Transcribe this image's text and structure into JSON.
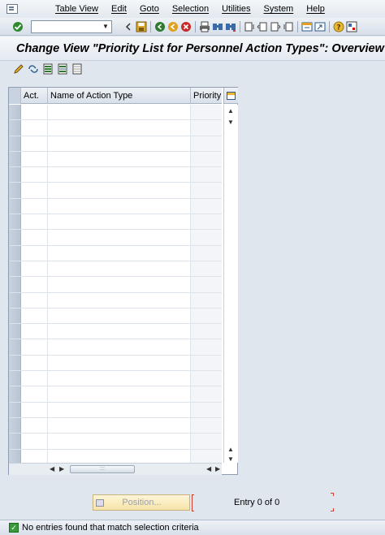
{
  "menubar": {
    "items": [
      "Table View",
      "Edit",
      "Goto",
      "Selection",
      "Utilities",
      "System",
      "Help"
    ]
  },
  "toolbar": {
    "command_field_value": "",
    "icons": [
      "enter-icon",
      "back-icon",
      "save-icon",
      "exit-icon",
      "cancel-icon",
      "print-icon",
      "find-icon",
      "find-next-icon",
      "first-page-icon",
      "previous-page-icon",
      "next-page-icon",
      "last-page-icon",
      "create-session-icon",
      "shortcut-icon",
      "help-icon",
      "layout-menu-icon"
    ]
  },
  "title": "Change View \"Priority List for Personnel Action Types\": Overview",
  "app_toolbar": {
    "icons": [
      "edit-icon",
      "display-change-icon",
      "select-all-icon",
      "select-block-icon",
      "deselect-all-icon"
    ]
  },
  "table": {
    "columns": [
      "Act.",
      "Name of Action Type",
      "Priority"
    ],
    "row_count": 23,
    "rows": []
  },
  "position_button": {
    "label": "Position..."
  },
  "entry_info": "Entry 0 of 0",
  "status": {
    "message": "No entries found that match selection criteria"
  },
  "colors": {
    "background": "#dfe6ee",
    "status_ok": "#3a9a3a",
    "position_button": "#f5e3a8"
  }
}
